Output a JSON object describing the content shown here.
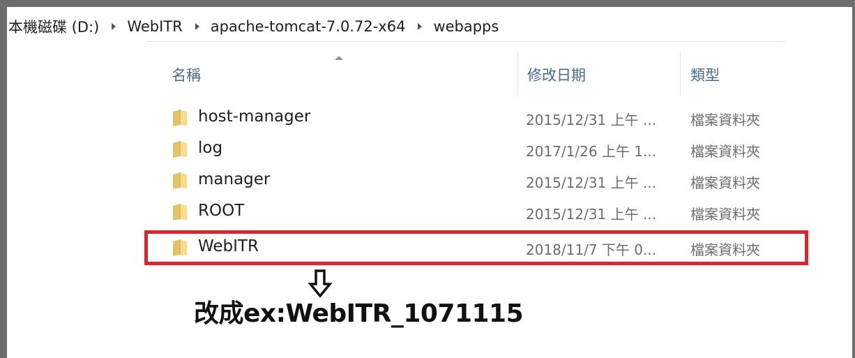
{
  "breadcrumb": [
    "本機磁碟 (D:)",
    "WebITR",
    "apache-tomcat-7.0.72-x64",
    "webapps"
  ],
  "columns": {
    "name": "名稱",
    "date": "修改日期",
    "type": "類型"
  },
  "files": [
    {
      "name": "host-manager",
      "date": "2015/12/31 上午 ...",
      "type": "檔案資料夾"
    },
    {
      "name": "log",
      "date": "2017/1/26 上午 1...",
      "type": "檔案資料夾"
    },
    {
      "name": "manager",
      "date": "2015/12/31 上午 ...",
      "type": "檔案資料夾"
    },
    {
      "name": "ROOT",
      "date": "2015/12/31 上午 ...",
      "type": "檔案資料夾"
    },
    {
      "name": "WebITR",
      "date": "2018/11/7 下午 0...",
      "type": "檔案資料夾"
    }
  ],
  "annotation": {
    "text": "改成ex:WebITR_1071115",
    "highlight_color": "#e0242b",
    "arrow_icon": "down-arrow-icon"
  },
  "icons": {
    "folder": "folder-icon",
    "separator": "chevron-right-icon",
    "sort": "sort-ascending-icon"
  }
}
